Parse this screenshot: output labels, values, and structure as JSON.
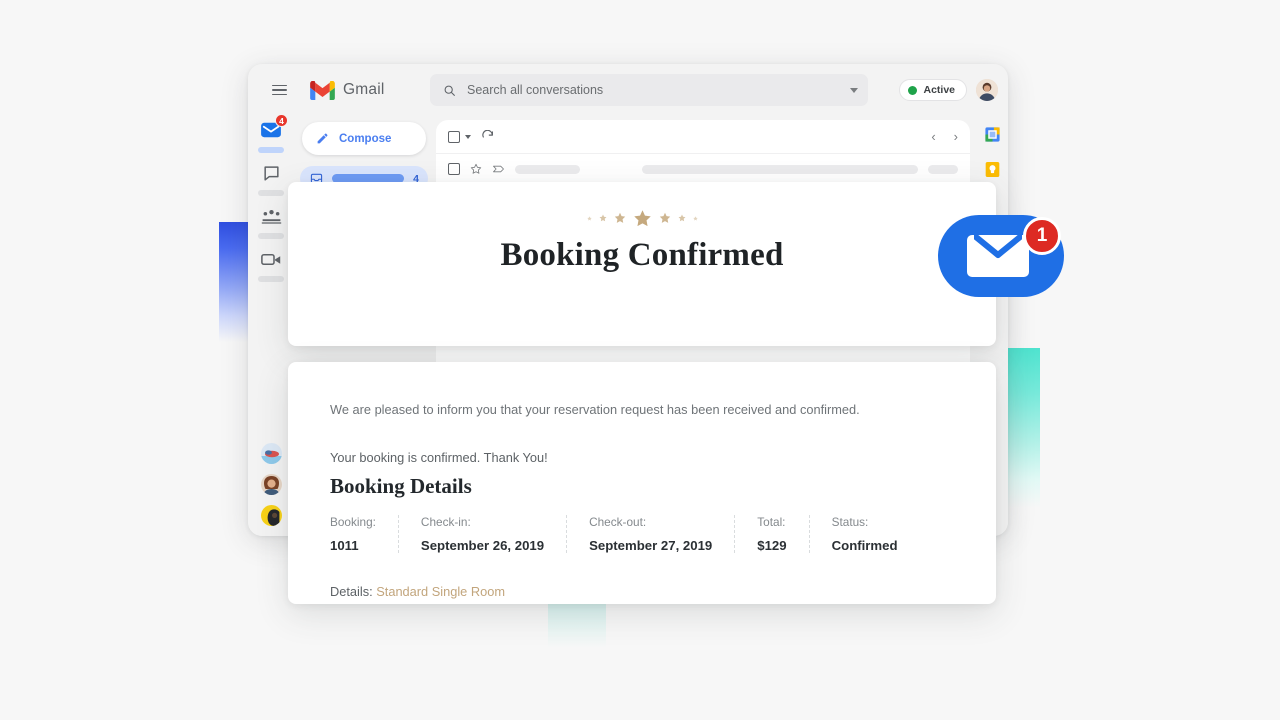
{
  "app": {
    "brand_name": "Gmail",
    "hamburger_icon": "hamburger-menu-icon",
    "logo_icon": "gmail-logo-icon"
  },
  "search": {
    "placeholder": "Search all conversations",
    "icon": "search-icon",
    "options_icon": "chevron-down-icon",
    "value": ""
  },
  "status": {
    "label": "Active",
    "dot_color": "#1fa34a"
  },
  "account": {
    "avatar_icon": "avatar"
  },
  "rail": {
    "items": [
      {
        "name": "mail",
        "icon": "mail-icon",
        "badge": "4",
        "active": true
      },
      {
        "name": "chat",
        "icon": "chat-bubble-icon",
        "badge": "",
        "active": false
      },
      {
        "name": "spaces",
        "icon": "spaces-people-icon",
        "badge": "",
        "active": false
      },
      {
        "name": "meet",
        "icon": "video-camera-icon",
        "badge": "",
        "active": false
      }
    ],
    "avatars": [
      "avatar-landscape",
      "avatar-person-1",
      "avatar-person-2"
    ]
  },
  "nav": {
    "compose_label": "Compose",
    "compose_icon": "pencil-icon",
    "inbox_icon": "inbox-icon",
    "inbox_count": "4"
  },
  "list_toolbar": {
    "select_all_icon": "checkbox-icon",
    "select_all_caret_icon": "chevron-down-icon",
    "refresh_icon": "refresh-icon",
    "prev_icon": "chevron-left-icon",
    "next_icon": "chevron-right-icon",
    "prev_label": "‹",
    "next_label": "›"
  },
  "mail_row": {
    "checkbox_icon": "checkbox-icon",
    "star_icon": "star-outline-icon",
    "important_icon": "important-marker-icon"
  },
  "apps_panel": {
    "items": [
      {
        "name": "google-calendar",
        "icon": "calendar-icon"
      },
      {
        "name": "google-keep",
        "icon": "keep-icon"
      }
    ]
  },
  "email": {
    "star_count": 7,
    "star_color": "#c5a97e",
    "title": "Booking Confirmed",
    "paragraph_intro": "We are pleased to inform you that your reservation request has been received and confirmed.",
    "paragraph_thanks": "Your booking is confirmed. Thank You!",
    "details_heading": "Booking Details",
    "details": [
      {
        "key": "Booking:",
        "value": "1011"
      },
      {
        "key": "Check-in:",
        "value": "September 26, 2019"
      },
      {
        "key": "Check-out:",
        "value": "September 27, 2019"
      },
      {
        "key": "Total:",
        "value": "$129"
      },
      {
        "key": "Status:",
        "value": "Confirmed"
      }
    ],
    "footer_label": "Details:",
    "footer_room": "Standard Single Room",
    "footer_room_color": "#c2a57c"
  },
  "notification": {
    "count": "1",
    "envelope_icon": "envelope-icon",
    "pill_color": "#1f6fe5",
    "badge_color": "#dd2a23"
  },
  "decor": {
    "blue_color": "#2f4fe0",
    "teal_color": "#4fe3cf"
  }
}
